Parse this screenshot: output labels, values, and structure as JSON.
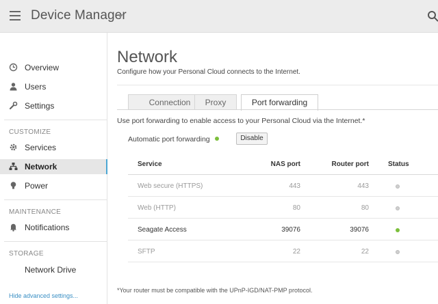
{
  "header": {
    "title": "Device Manager",
    "menu_icon": "hamburger-icon",
    "search_icon": "search-icon"
  },
  "sidebar": {
    "items_top": [
      {
        "label": "Overview",
        "icon": "clock-icon"
      },
      {
        "label": "Users",
        "icon": "user-icon"
      },
      {
        "label": "Settings",
        "icon": "wrench-icon"
      }
    ],
    "section_customize": "CUSTOMIZE",
    "items_customize": [
      {
        "label": "Services",
        "icon": "gear-icon"
      },
      {
        "label": "Network",
        "icon": "network-icon",
        "active": true
      },
      {
        "label": "Power",
        "icon": "bulb-icon"
      }
    ],
    "section_maintenance": "MAINTENANCE",
    "items_maintenance": [
      {
        "label": "Notifications",
        "icon": "bell-icon"
      }
    ],
    "section_storage": "STORAGE",
    "items_storage": [
      {
        "label": "Network Drive",
        "icon": "drive-icon"
      }
    ],
    "advanced_link": "Hide advanced settings..."
  },
  "main": {
    "title": "Network",
    "subtitle": "Configure how your Personal Cloud connects to the Internet.",
    "tabs": [
      {
        "label": "Connection",
        "active": false
      },
      {
        "label": "Proxy",
        "active": false
      },
      {
        "label": "Port forwarding",
        "active": true
      }
    ],
    "intro": "Use port forwarding to enable access to your Personal Cloud via the Internet.*",
    "auto_forwarding_label": "Automatic port forwarding",
    "auto_forwarding_status": "enabled",
    "disable_button": "Disable",
    "table": {
      "columns": [
        "Service",
        "NAS port",
        "Router port",
        "Status"
      ],
      "rows": [
        {
          "service": "Web secure (HTTPS)",
          "nas_port": "443",
          "router_port": "443",
          "status": "inactive"
        },
        {
          "service": "Web (HTTP)",
          "nas_port": "80",
          "router_port": "80",
          "status": "inactive"
        },
        {
          "service": "Seagate Access",
          "nas_port": "39076",
          "router_port": "39076",
          "status": "active"
        },
        {
          "service": "SFTP",
          "nas_port": "22",
          "router_port": "22",
          "status": "inactive"
        }
      ]
    },
    "footnote": "*Your router must be compatible with the UPnP-IGD/NAT-PMP protocol."
  },
  "colors": {
    "active_green": "#7cbf3b",
    "inactive_gray": "#cfcfcf",
    "accent_blue": "#4aa6d3",
    "link_blue": "#3a8fc4"
  }
}
